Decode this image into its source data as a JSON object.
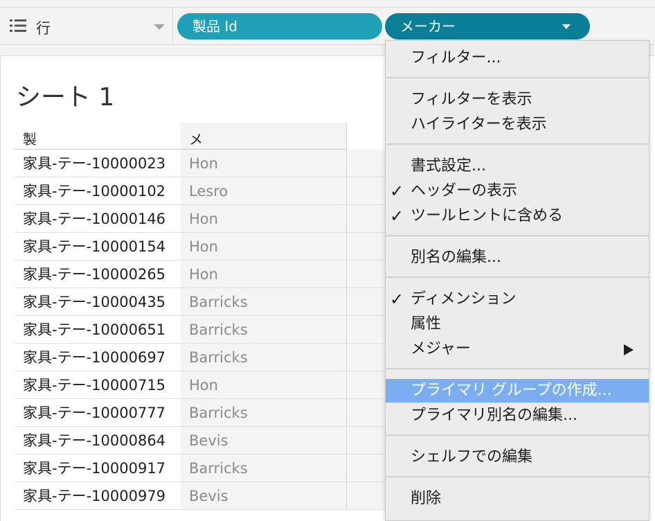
{
  "shelf": {
    "label": "行",
    "pills": [
      "製品 Id",
      "メーカー"
    ]
  },
  "sheet": {
    "title": "シート 1",
    "columns": [
      "製品 Id",
      "メーカー"
    ],
    "rows": [
      {
        "id": "家具-テー-10000023",
        "maker": "Hon"
      },
      {
        "id": "家具-テー-10000102",
        "maker": "Lesro"
      },
      {
        "id": "家具-テー-10000146",
        "maker": "Hon"
      },
      {
        "id": "家具-テー-10000154",
        "maker": "Hon"
      },
      {
        "id": "家具-テー-10000265",
        "maker": "Hon"
      },
      {
        "id": "家具-テー-10000435",
        "maker": "Barricks"
      },
      {
        "id": "家具-テー-10000651",
        "maker": "Barricks"
      },
      {
        "id": "家具-テー-10000697",
        "maker": "Barricks"
      },
      {
        "id": "家具-テー-10000715",
        "maker": "Hon"
      },
      {
        "id": "家具-テー-10000777",
        "maker": "Barricks"
      },
      {
        "id": "家具-テー-10000864",
        "maker": "Bevis"
      },
      {
        "id": "家具-テー-10000917",
        "maker": "Barricks"
      },
      {
        "id": "家具-テー-10000979",
        "maker": "Bevis"
      }
    ]
  },
  "menu": {
    "items": [
      {
        "label": "フィルター..."
      },
      {
        "label": "フィルターを表示"
      },
      {
        "label": "ハイライターを表示"
      },
      {
        "label": "書式設定..."
      },
      {
        "label": "ヘッダーの表示",
        "checked": true
      },
      {
        "label": "ツールヒントに含める",
        "checked": true
      },
      {
        "label": "別名の編集..."
      },
      {
        "label": "ディメンション",
        "checked": true
      },
      {
        "label": "属性"
      },
      {
        "label": "メジャー",
        "submenu": true
      },
      {
        "label": "プライマリ グループの作成...",
        "highlighted": true
      },
      {
        "label": "プライマリ別名の編集..."
      },
      {
        "label": "シェルフでの編集"
      },
      {
        "label": "削除"
      }
    ],
    "check_glyph": "✓"
  },
  "colors": {
    "pill_light": "#20a0b7",
    "pill_dark": "#0a7f97",
    "menu_highlight": "#7aaef0"
  }
}
